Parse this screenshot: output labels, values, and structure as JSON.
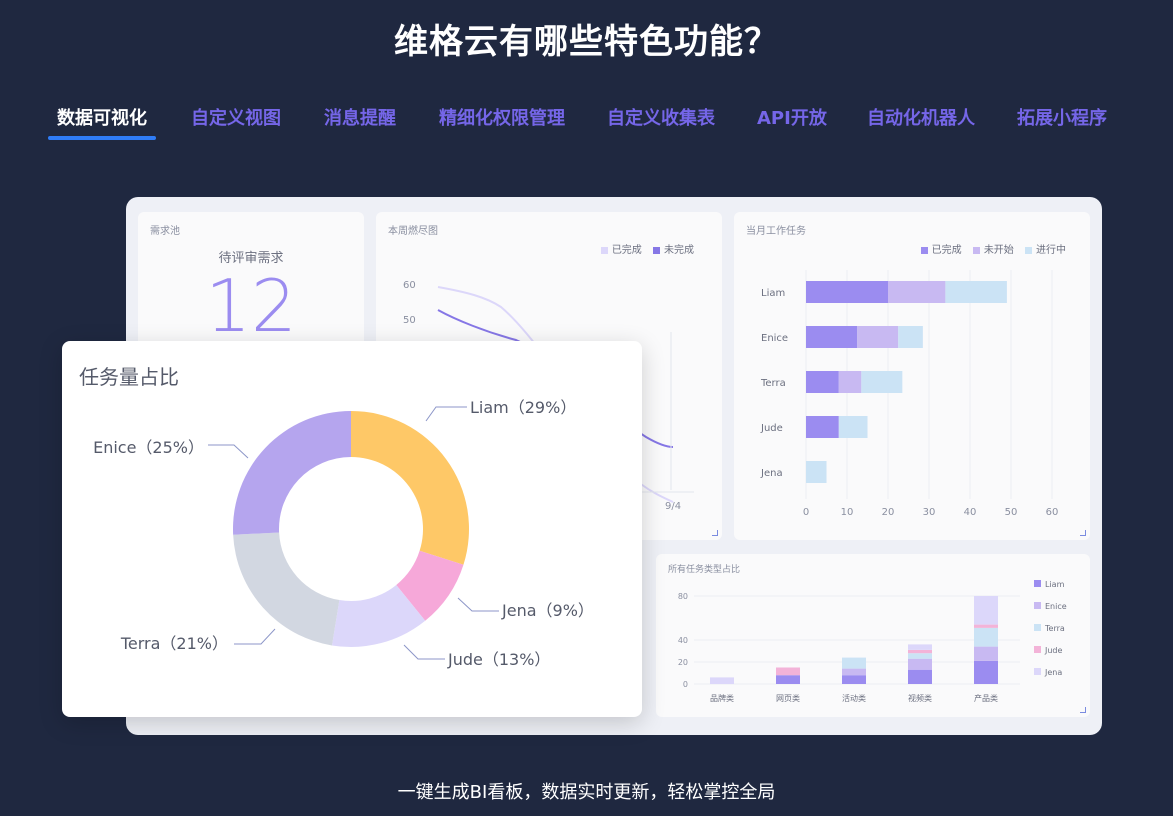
{
  "page": {
    "title": "维格云有哪些特色功能？",
    "footer": "一键生成BI看板，数据实时更新，轻松掌控全局"
  },
  "tabs": [
    {
      "label": "数据可视化",
      "active": true
    },
    {
      "label": "自定义视图",
      "active": false
    },
    {
      "label": "消息提醒",
      "active": false
    },
    {
      "label": "精细化权限管理",
      "active": false
    },
    {
      "label": "自定义收集表",
      "active": false
    },
    {
      "label": "API开放",
      "active": false
    },
    {
      "label": "自动化机器人",
      "active": false
    },
    {
      "label": "拓展小程序",
      "active": false
    }
  ],
  "colors": {
    "accent": "#2f7cf6",
    "tab_inactive": "#7566e8",
    "background": "#1f2840",
    "purple": "#9b8cf0",
    "lavender": "#c8b9f2",
    "light_blue": "#cbe3f5",
    "pink": "#f3b3d8",
    "pale_lavender": "#dcd7fa",
    "yellow": "#fec867",
    "gray": "#d2d7e1"
  },
  "dashboard": {
    "pending": {
      "card_title": "需求池",
      "label": "待评审需求",
      "value": "12"
    },
    "burndown": {
      "card_title": "本周燃尽图",
      "legend": [
        "已完成",
        "未完成"
      ],
      "y_ticks": [
        "60",
        "50"
      ],
      "x_tick": "9/4"
    },
    "monthly_tasks": {
      "card_title": "当月工作任务",
      "legend": [
        "已完成",
        "未开始",
        "进行中"
      ]
    },
    "task_types": {
      "card_title": "所有任务类型占比"
    },
    "task_share": {
      "card_title": "任务量占比"
    }
  },
  "chart_data": [
    {
      "type": "bar",
      "orientation": "horizontal",
      "title": "当月工作任务",
      "categories": [
        "Liam",
        "Enice",
        "Terra",
        "Jude",
        "Jena"
      ],
      "stacked": true,
      "series": [
        {
          "name": "已完成",
          "values": [
            20,
            12.5,
            8,
            8,
            0
          ],
          "color": "#9b8cf0"
        },
        {
          "name": "未开始",
          "values": [
            14,
            10,
            5.5,
            0,
            0
          ],
          "color": "#c8b9f2"
        },
        {
          "name": "进行中",
          "values": [
            15,
            6,
            10,
            7,
            5
          ],
          "color": "#cbe3f5"
        }
      ],
      "xlim": [
        0,
        60
      ],
      "x_ticks": [
        "0",
        "10",
        "20",
        "30",
        "40",
        "50",
        "60"
      ],
      "legend_position": "top-right",
      "grid": true
    },
    {
      "type": "bar",
      "title": "所有任务类型占比",
      "categories": [
        "品牌类",
        "网页类",
        "活动类",
        "视频类",
        "产品类"
      ],
      "stacked": true,
      "series": [
        {
          "name": "Liam",
          "values": [
            0,
            8,
            8,
            13,
            21
          ],
          "color": "#9b8cf0"
        },
        {
          "name": "Enice",
          "values": [
            0,
            0,
            6,
            10,
            13
          ],
          "color": "#c8b9f2"
        },
        {
          "name": "Terra",
          "values": [
            0,
            0,
            10,
            5,
            17
          ],
          "color": "#cbe3f5"
        },
        {
          "name": "Jude",
          "values": [
            0,
            7,
            0,
            3,
            3
          ],
          "color": "#f3b3d8"
        },
        {
          "name": "Jena",
          "values": [
            6,
            0,
            0,
            5,
            26
          ],
          "color": "#dcd7fa"
        }
      ],
      "ylim": [
        0,
        80
      ],
      "y_ticks": [
        "80",
        "40",
        "20",
        "0"
      ],
      "legend_position": "right",
      "grid": true
    },
    {
      "type": "pie",
      "title": "任务量占比",
      "donut": true,
      "categories": [
        "Liam",
        "Jena",
        "Jude",
        "Terra",
        "Enice"
      ],
      "values": [
        29,
        9,
        13,
        21,
        25
      ],
      "labels": [
        "Liam（29%）",
        "Jena（9%）",
        "Jude（13%）",
        "Terra（21%）",
        "Enice（25%）"
      ],
      "colors": [
        "#fec867",
        "#f6a8d9",
        "#dcd7fa",
        "#d2d7e1",
        "#b5a5ee"
      ]
    }
  ]
}
